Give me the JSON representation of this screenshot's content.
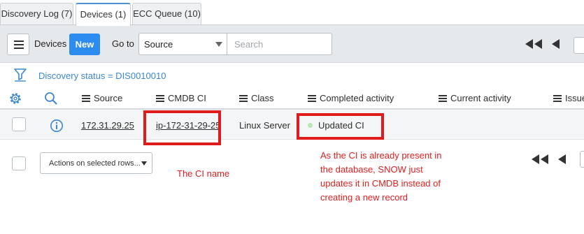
{
  "tabs": [
    {
      "label": "Discovery Log (7)",
      "active": false
    },
    {
      "label": "Devices (1)",
      "active": true
    },
    {
      "label": "ECC Queue (10)",
      "active": false
    }
  ],
  "toolbar": {
    "title": "Devices",
    "new_label": "New",
    "goto_label": "Go to",
    "goto_selected": "Source",
    "search_placeholder": "Search"
  },
  "breadcrumb": "Discovery status = DIS0010010",
  "columns": [
    "Source",
    "CMDB CI",
    "Class",
    "Completed activity",
    "Current activity",
    "Issues"
  ],
  "row": {
    "source": "172.31.29.25",
    "cmdb_ci": "ip-172-31-29-25",
    "class": "Linux Server",
    "completed_activity": "Updated CI"
  },
  "list_actions": {
    "selected": "Actions on selected rows..."
  },
  "annotations": {
    "ci_name": "The CI name",
    "explanation": [
      "As the CI is already present in",
      "the database, SNOW just",
      "updates it in CMDB instead of",
      "creating a new record"
    ]
  },
  "colors": {
    "accent": "#2d8cf0",
    "link": "#3b87d0",
    "highlight": "#e01b1b",
    "status_ok": "#b9e6b3"
  },
  "icons": [
    "hamburger-icon",
    "first-page-icon",
    "previous-page-icon",
    "filter-funnel-icon",
    "gear-icon",
    "search-icon",
    "info-icon",
    "caret-down-icon"
  ]
}
